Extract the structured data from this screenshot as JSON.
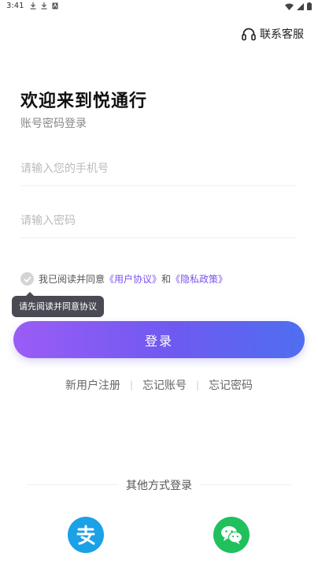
{
  "status_bar": {
    "time": "3:41"
  },
  "header": {
    "support_label": "联系客服"
  },
  "page": {
    "title": "欢迎来到悦通行",
    "subtitle": "账号密码登录"
  },
  "form": {
    "phone_placeholder": "请输入您的手机号",
    "password_placeholder": "请输入密码"
  },
  "agreement": {
    "prefix": "我已阅读并同意",
    "user_agreement": "《用户协议》",
    "conjunction": "和",
    "privacy_policy": "《隐私政策》",
    "tooltip": "请先阅读并同意协议"
  },
  "login_button": {
    "label": "登录"
  },
  "links": {
    "register": "新用户注册",
    "forgot_account": "忘记账号",
    "forgot_password": "忘记密码"
  },
  "other_login": {
    "label": "其他方式登录"
  },
  "colors": {
    "accent": "#7b52f0",
    "gradient_start": "#9b5cf6",
    "gradient_end": "#4f6ef0",
    "alipay": "#1aa1e6",
    "wechat": "#20c05c"
  },
  "icons": {
    "support": "headset-icon",
    "alipay": "alipay-icon",
    "wechat": "wechat-icon",
    "check": "check-icon"
  }
}
